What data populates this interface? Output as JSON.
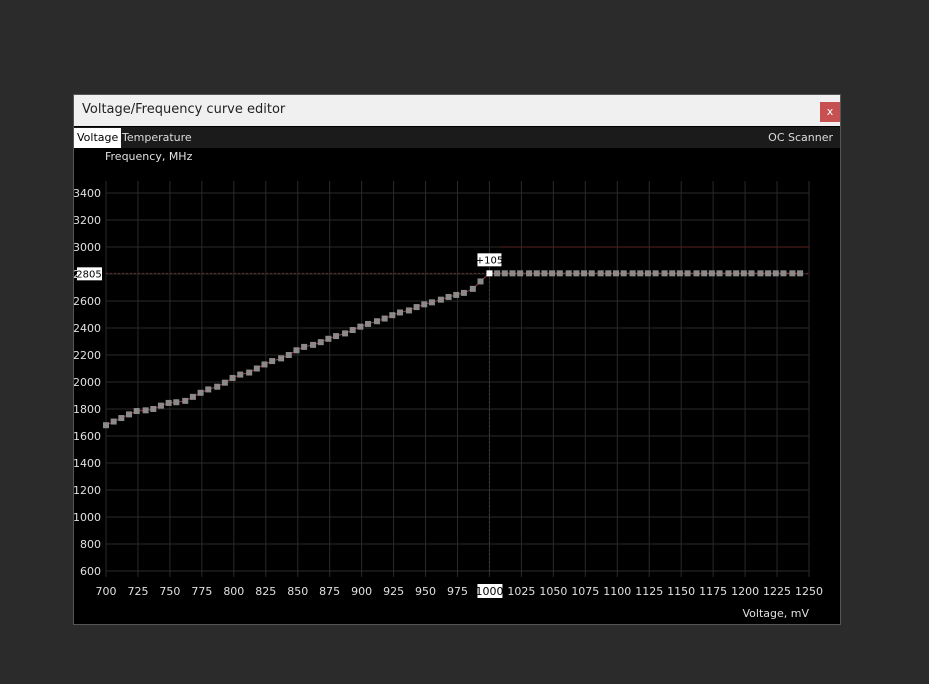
{
  "window": {
    "title": "Voltage/Frequency curve editor",
    "close_label": "x"
  },
  "tabs": [
    {
      "label": "Voltage",
      "active": true
    },
    {
      "label": "Temperature",
      "active": false
    }
  ],
  "oc_scanner_label": "OC Scanner",
  "colors": {
    "background": "#000000",
    "grid": "#2a2a2a",
    "point": "#8a8a8a",
    "curve_line": "#a33a3a",
    "selected_point": "#ffffff"
  },
  "chart_data": {
    "type": "scatter",
    "ylabel": "Frequency, MHz",
    "xlabel": "Voltage, mV",
    "xlim": [
      700,
      1250
    ],
    "ylim": [
      600,
      3400
    ],
    "xticks": [
      700,
      725,
      750,
      775,
      800,
      825,
      850,
      875,
      900,
      925,
      950,
      975,
      1000,
      1025,
      1050,
      1075,
      1100,
      1125,
      1150,
      1175,
      1200,
      1225,
      1250
    ],
    "yticks": [
      600,
      800,
      1000,
      1200,
      1400,
      1600,
      1800,
      2000,
      2200,
      2400,
      2600,
      2800,
      3000,
      3200,
      3400
    ],
    "grid": true,
    "selected_point": {
      "x": 1000,
      "y": 2805,
      "offset_label": "+105"
    },
    "selected_x_label": "1000",
    "selected_y_label": "2805",
    "limit_line": 2805,
    "upper_line": 3000,
    "points": [
      [
        700,
        1680
      ],
      [
        706,
        1707
      ],
      [
        712,
        1733
      ],
      [
        718,
        1760
      ],
      [
        724,
        1785
      ],
      [
        731,
        1790
      ],
      [
        737,
        1800
      ],
      [
        743,
        1825
      ],
      [
        749,
        1845
      ],
      [
        755,
        1850
      ],
      [
        762,
        1860
      ],
      [
        768,
        1890
      ],
      [
        774,
        1920
      ],
      [
        780,
        1945
      ],
      [
        787,
        1965
      ],
      [
        793,
        1995
      ],
      [
        799,
        2030
      ],
      [
        805,
        2055
      ],
      [
        812,
        2070
      ],
      [
        818,
        2100
      ],
      [
        824,
        2130
      ],
      [
        830,
        2155
      ],
      [
        837,
        2175
      ],
      [
        843,
        2200
      ],
      [
        849,
        2235
      ],
      [
        855,
        2260
      ],
      [
        862,
        2275
      ],
      [
        868,
        2295
      ],
      [
        874,
        2320
      ],
      [
        880,
        2340
      ],
      [
        887,
        2360
      ],
      [
        893,
        2385
      ],
      [
        899,
        2410
      ],
      [
        905,
        2430
      ],
      [
        912,
        2450
      ],
      [
        918,
        2470
      ],
      [
        924,
        2495
      ],
      [
        930,
        2515
      ],
      [
        937,
        2530
      ],
      [
        943,
        2555
      ],
      [
        949,
        2575
      ],
      [
        955,
        2590
      ],
      [
        962,
        2610
      ],
      [
        968,
        2630
      ],
      [
        974,
        2645
      ],
      [
        980,
        2660
      ],
      [
        987,
        2690
      ],
      [
        993,
        2745
      ],
      [
        1000,
        2805
      ],
      [
        1006,
        2805
      ],
      [
        1012,
        2805
      ],
      [
        1018,
        2805
      ],
      [
        1024,
        2805
      ],
      [
        1031,
        2805
      ],
      [
        1037,
        2805
      ],
      [
        1043,
        2805
      ],
      [
        1049,
        2805
      ],
      [
        1055,
        2805
      ],
      [
        1062,
        2805
      ],
      [
        1068,
        2805
      ],
      [
        1074,
        2805
      ],
      [
        1080,
        2805
      ],
      [
        1087,
        2805
      ],
      [
        1093,
        2805
      ],
      [
        1099,
        2805
      ],
      [
        1105,
        2805
      ],
      [
        1112,
        2805
      ],
      [
        1118,
        2805
      ],
      [
        1124,
        2805
      ],
      [
        1130,
        2805
      ],
      [
        1137,
        2805
      ],
      [
        1143,
        2805
      ],
      [
        1149,
        2805
      ],
      [
        1155,
        2805
      ],
      [
        1162,
        2805
      ],
      [
        1168,
        2805
      ],
      [
        1174,
        2805
      ],
      [
        1180,
        2805
      ],
      [
        1187,
        2805
      ],
      [
        1193,
        2805
      ],
      [
        1199,
        2805
      ],
      [
        1205,
        2805
      ],
      [
        1212,
        2805
      ],
      [
        1218,
        2805
      ],
      [
        1224,
        2805
      ],
      [
        1230,
        2805
      ],
      [
        1237,
        2805
      ],
      [
        1243,
        2805
      ]
    ]
  }
}
